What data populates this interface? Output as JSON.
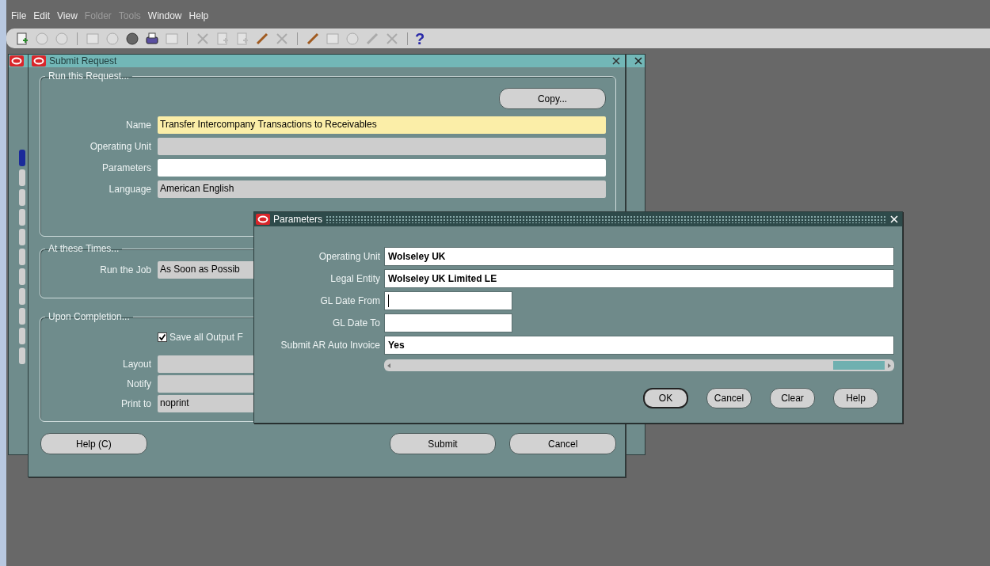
{
  "menu": [
    {
      "label": "File",
      "disabled": false
    },
    {
      "label": "Edit",
      "disabled": false
    },
    {
      "label": "View",
      "disabled": false
    },
    {
      "label": "Folder",
      "disabled": true
    },
    {
      "label": "Tools",
      "disabled": true
    },
    {
      "label": "Window",
      "disabled": false
    },
    {
      "label": "Help",
      "disabled": false
    }
  ],
  "toolbar": {
    "help_glyph": "?"
  },
  "back_window": {
    "side_tabs": [
      {
        "selected": true
      },
      {
        "selected": false
      },
      {
        "selected": false
      },
      {
        "selected": false
      },
      {
        "selected": false
      },
      {
        "selected": false
      },
      {
        "selected": false
      },
      {
        "selected": false
      },
      {
        "selected": false
      },
      {
        "selected": false
      },
      {
        "selected": false
      }
    ]
  },
  "submit_request": {
    "title": "Submit Request",
    "run_this_request": {
      "legend": "Run this Request...",
      "copy_button": "Copy...",
      "fields": [
        {
          "label": "Name",
          "value": "Transfer Intercompany Transactions to Receivables",
          "kind": "current"
        },
        {
          "label": "Operating Unit",
          "kind": "readonly"
        },
        {
          "label": "Parameters",
          "kind": "editable"
        },
        {
          "label": "Language",
          "value": "American English",
          "kind": "readonly"
        }
      ]
    },
    "at_these_times": {
      "legend": "At these Times...",
      "fields": [
        {
          "label": "Run the Job",
          "value": "As Soon as Possib",
          "kind": "readonly"
        }
      ]
    },
    "upon_completion": {
      "legend": "Upon Completion...",
      "checkbox": {
        "label": "Save all Output F",
        "checked": true
      },
      "fields": [
        {
          "label": "Layout",
          "kind": "readonly"
        },
        {
          "label": "Notify",
          "kind": "readonly"
        },
        {
          "label": "Print to",
          "value": "noprint",
          "kind": "readonly"
        }
      ]
    },
    "buttons": [
      "Help (C)",
      "Submit",
      "Cancel"
    ]
  },
  "parameters_dialog": {
    "title": "Parameters",
    "fields": [
      {
        "label": "Operating Unit",
        "value": "Wolseley UK",
        "kind": "wide",
        "focused": false
      },
      {
        "label": "Legal Entity",
        "value": "Wolseley UK Limited LE",
        "kind": "wide",
        "focused": false
      },
      {
        "label": "GL Date From",
        "kind": "short",
        "focused": true
      },
      {
        "label": "GL Date To",
        "kind": "short",
        "focused": false
      },
      {
        "label": "Submit AR Auto Invoice",
        "value": "Yes",
        "kind": "wide",
        "focused": false
      }
    ],
    "buttons": [
      {
        "label": "OK",
        "default": true
      },
      {
        "label": "Cancel",
        "default": false
      },
      {
        "label": "Clear",
        "default": false
      },
      {
        "label": "Help",
        "default": false
      }
    ]
  }
}
